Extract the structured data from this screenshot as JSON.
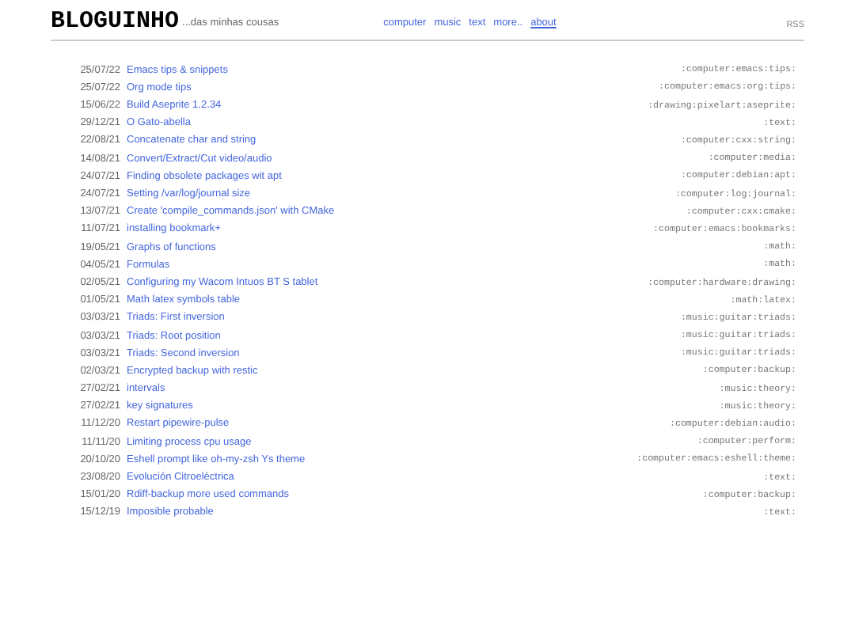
{
  "header": {
    "title": "BLOGUINHO",
    "subtitle": "...das minhas cousas",
    "nav": [
      {
        "label": "computer",
        "selected": false
      },
      {
        "label": "music",
        "selected": false
      },
      {
        "label": "text",
        "selected": false
      },
      {
        "label": "more..",
        "selected": false
      },
      {
        "label": "about",
        "selected": true
      }
    ],
    "rss": "RSS"
  },
  "posts": [
    {
      "date": "25/07/22",
      "title": "Emacs tips & snippets",
      "tags": ":computer:emacs:tips:"
    },
    {
      "date": "25/07/22",
      "title": "Org mode tips",
      "tags": ":computer:emacs:org:tips:"
    },
    {
      "date": "15/06/22",
      "title": "Build Aseprite 1.2.34",
      "tags": ":drawing:pixelart:aseprite:"
    },
    {
      "date": "29/12/21",
      "title": "O Gato-abella",
      "tags": ":text:"
    },
    {
      "date": "22/08/21",
      "title": "Concatenate char and string",
      "tags": ":computer:cxx:string:"
    },
    {
      "date": "14/08/21",
      "title": "Convert/Extract/Cut video/audio",
      "tags": ":computer:media:"
    },
    {
      "date": "24/07/21",
      "title": "Finding obsolete packages wit apt",
      "tags": ":computer:debian:apt:"
    },
    {
      "date": "24/07/21",
      "title": "Setting /var/log/journal size",
      "tags": ":computer:log:journal:"
    },
    {
      "date": "13/07/21",
      "title": "Create 'compile_commands.json' with CMake",
      "tags": ":computer:cxx:cmake:"
    },
    {
      "date": "11/07/21",
      "title": "installing bookmark+",
      "tags": ":computer:emacs:bookmarks:"
    },
    {
      "date": "19/05/21",
      "title": "Graphs of functions",
      "tags": ":math:"
    },
    {
      "date": "04/05/21",
      "title": "Formulas",
      "tags": ":math:"
    },
    {
      "date": "02/05/21",
      "title": "Configuring my Wacom Intuos BT S tablet",
      "tags": ":computer:hardware:drawing:"
    },
    {
      "date": "01/05/21",
      "title": "Math latex symbols table",
      "tags": ":math:latex:"
    },
    {
      "date": "03/03/21",
      "title": "Triads: First inversion",
      "tags": ":music:guitar:triads:"
    },
    {
      "date": "03/03/21",
      "title": "Triads: Root position",
      "tags": ":music:guitar:triads:"
    },
    {
      "date": "03/03/21",
      "title": "Triads: Second inversion",
      "tags": ":music:guitar:triads:"
    },
    {
      "date": "02/03/21",
      "title": "Encrypted backup with restic",
      "tags": ":computer:backup:"
    },
    {
      "date": "27/02/21",
      "title": "intervals",
      "tags": ":music:theory:"
    },
    {
      "date": "27/02/21",
      "title": "key signatures",
      "tags": ":music:theory:"
    },
    {
      "date": "11/12/20",
      "title": "Restart pipewire-pulse",
      "tags": ":computer:debian:audio:"
    },
    {
      "date": "11/11/20",
      "title": "Limiting process cpu usage",
      "tags": ":computer:perform:"
    },
    {
      "date": "20/10/20",
      "title": "Eshell prompt like oh-my-zsh Ys theme",
      "tags": ":computer:emacs:eshell:theme:"
    },
    {
      "date": "23/08/20",
      "title": "Evolución Citroeléctrica",
      "tags": ":text:"
    },
    {
      "date": "15/01/20",
      "title": "Rdiff-backup more used commands",
      "tags": ":computer:backup:"
    },
    {
      "date": "15/12/19",
      "title": "Imposible probable",
      "tags": ":text:"
    }
  ]
}
